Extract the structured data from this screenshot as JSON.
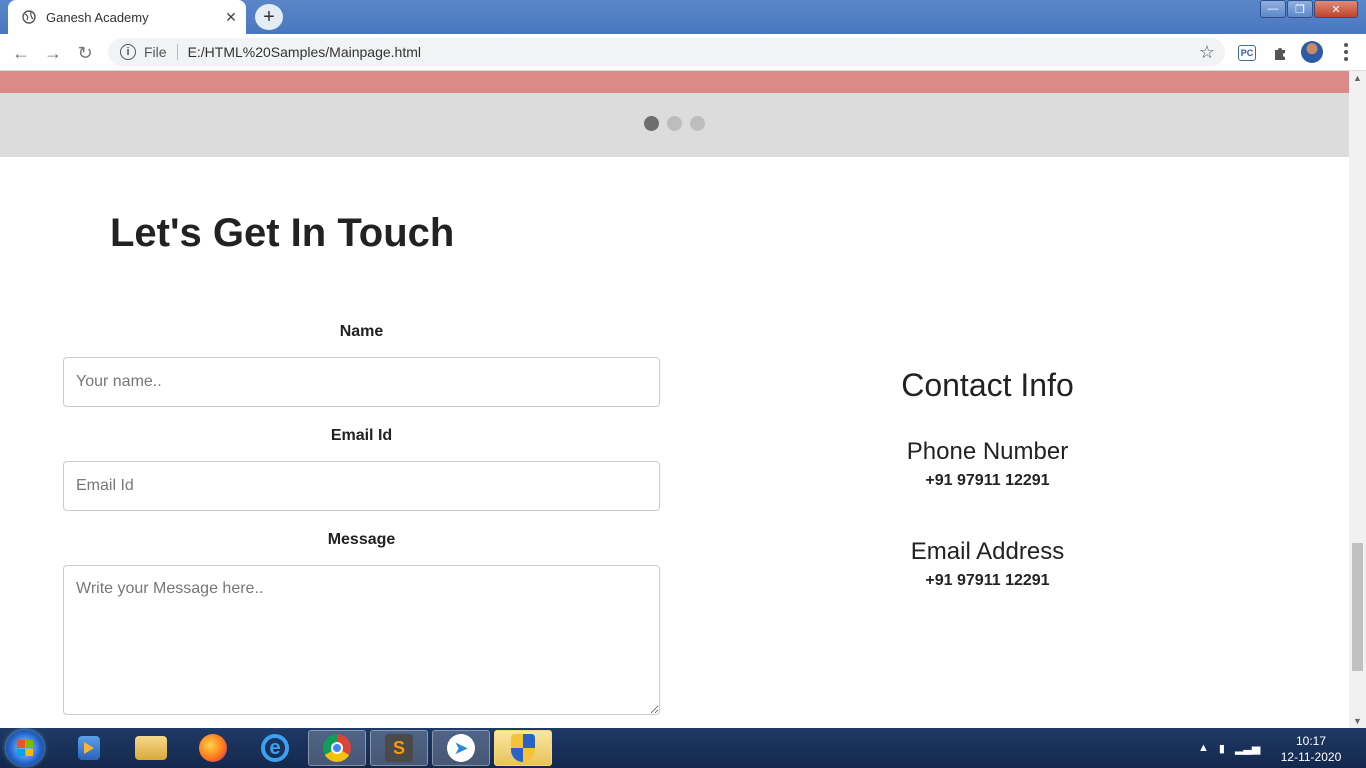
{
  "browser": {
    "tab_title": "Ganesh Academy",
    "tab_close": "✕",
    "new_tab": "+",
    "omnibox_scheme": "File",
    "url": "E:/HTML%20Samples/Mainpage.html",
    "window_buttons": [
      "—",
      "❐",
      "✕"
    ]
  },
  "carousel": {
    "dots": 3,
    "active_index": 0
  },
  "contact_section": {
    "headline": "Let's Get In Touch",
    "form": {
      "name_label": "Name",
      "name_placeholder": "Your name..",
      "email_label": "Email Id",
      "email_placeholder": "Email Id",
      "message_label": "Message",
      "message_placeholder": "Write your Message here.."
    },
    "info": {
      "title": "Contact Info",
      "phone_heading": "Phone Number",
      "phone_value": "+91 97911 12291",
      "email_heading": "Email Address",
      "email_value": "+91 97911 12291"
    }
  },
  "taskbar": {
    "apps": [
      "windows-media-player",
      "file-explorer",
      "firefox",
      "internet-explorer",
      "chrome",
      "sublime-text",
      "paper-plane-app",
      "security-shield"
    ],
    "clock_time": "10:17",
    "clock_date": "12-11-2020"
  },
  "colors": {
    "titlebar": "#4a78c0",
    "pink_bar": "#dc8a87",
    "carousel_bg": "#dcdcdc",
    "taskbar": "#14284d"
  }
}
